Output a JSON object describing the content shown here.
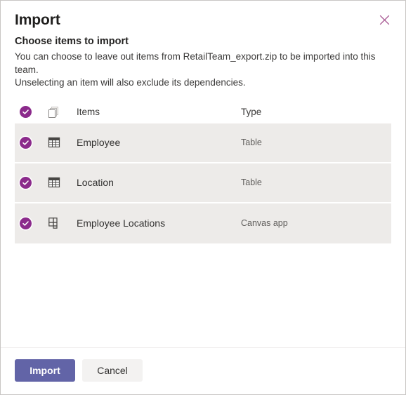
{
  "dialog": {
    "title": "Import",
    "close_icon": "close-icon",
    "subtitle": "Choose items to import",
    "description_line1": "You can choose to leave out items from RetailTeam_export.zip to be imported into this team.",
    "description_line2": "Unselecting an item will also exclude its dependencies."
  },
  "table": {
    "header": {
      "select_all_icon": "check-circle-filled-icon",
      "file_icon": "copy-pages-icon",
      "items_label": "Items",
      "type_label": "Type"
    },
    "rows": [
      {
        "selected_icon": "check-circle-filled-icon",
        "type_icon": "table-grid-icon",
        "name": "Employee",
        "type": "Table"
      },
      {
        "selected_icon": "check-circle-filled-icon",
        "type_icon": "table-grid-icon",
        "name": "Location",
        "type": "Table"
      },
      {
        "selected_icon": "check-circle-filled-icon",
        "type_icon": "canvas-app-icon",
        "name": "Employee Locations",
        "type": "Canvas app"
      }
    ]
  },
  "footer": {
    "import_label": "Import",
    "cancel_label": "Cancel"
  },
  "colors": {
    "accent_purple": "#6264a7",
    "check_purple": "#8b2a8b",
    "row_background": "#edebe9",
    "dialog_border": "#c8c6c4",
    "close_icon": "#a4528f"
  }
}
